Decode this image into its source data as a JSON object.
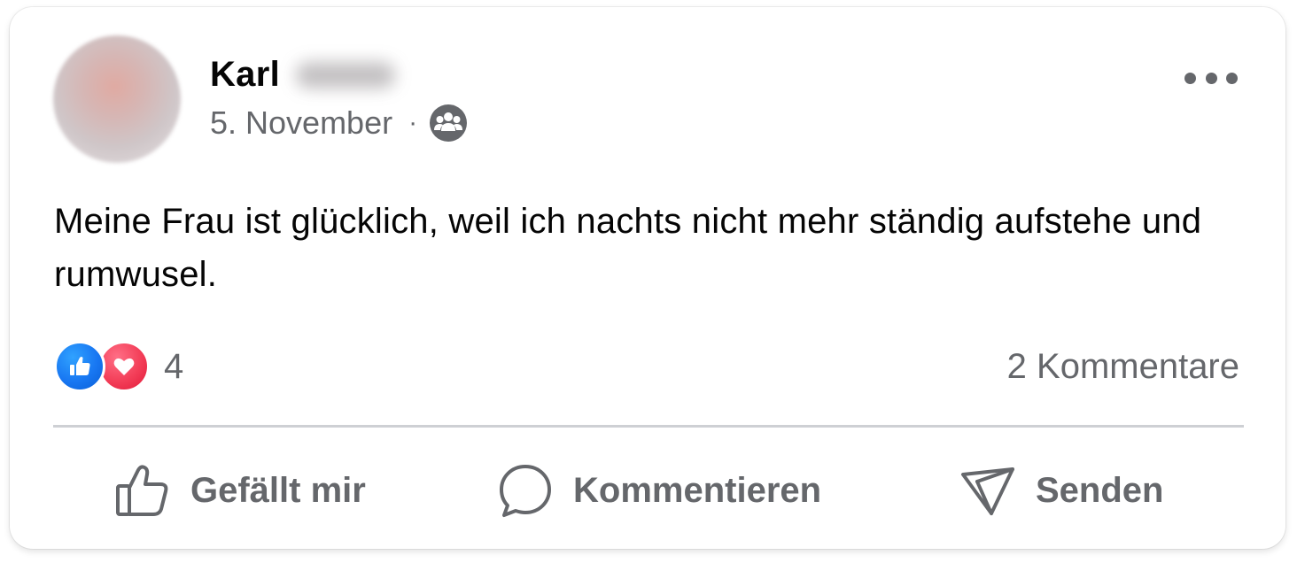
{
  "post": {
    "author": {
      "first_name": "Karl",
      "last_name_blurred": true
    },
    "date": "5. November",
    "separator": "·",
    "audience_icon": "group-audience-icon",
    "menu_icon": "more-options-icon",
    "text": "Meine Frau ist glücklich, weil ich nachts nicht mehr ständig aufstehe und rumwusel.",
    "reactions": {
      "types": [
        "like",
        "love"
      ],
      "count": "4"
    },
    "comments_label": "2 Kommentare"
  },
  "actions": {
    "like_label": "Gefällt mir",
    "comment_label": "Kommentieren",
    "send_label": "Senden"
  },
  "colors": {
    "secondary_text": "#65676b",
    "primary_text": "#050505",
    "like_blue": "#1877f2",
    "love_red": "#f33e58",
    "divider": "#ced0d4"
  }
}
